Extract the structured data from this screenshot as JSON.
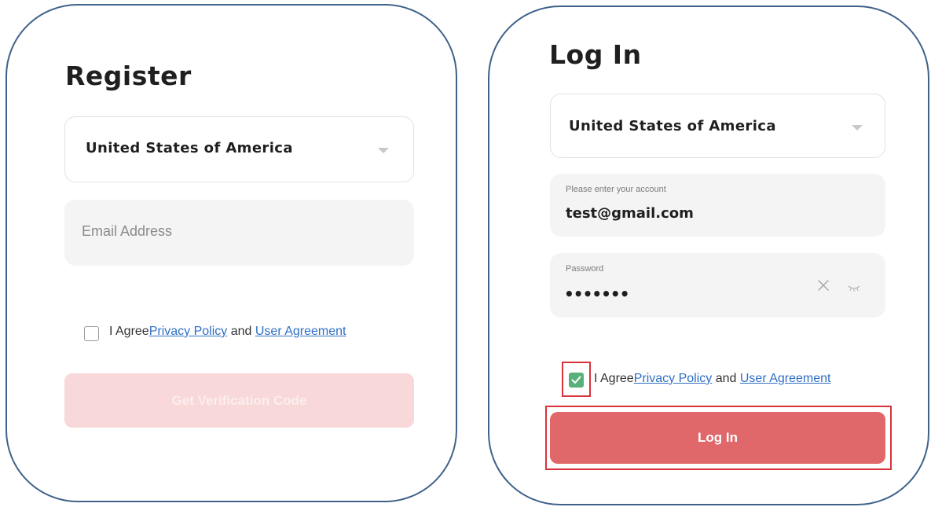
{
  "register": {
    "title": "Register",
    "country": "United States of America",
    "email_placeholder": "Email Address",
    "agree_prefix": "I Agree",
    "privacy_link": "Privacy Policy",
    "and_text": " and ",
    "user_agreement_link": "User Agreement",
    "checkbox_checked": false,
    "submit_label": "Get Verification Code"
  },
  "login": {
    "title": "Log In",
    "country": "United States of America",
    "account_label": "Please enter your account",
    "account_value": "test@gmail.com",
    "password_label": "Password",
    "password_value": "•••••••",
    "agree_prefix": "I Agree",
    "privacy_link": "Privacy Policy",
    "and_text": " and ",
    "user_agreement_link": "User Agreement",
    "checkbox_checked": true,
    "submit_label": "Log In"
  },
  "icons": {
    "caret": "chevron-down-icon",
    "clear": "close-icon",
    "visibility": "eye-closed-icon",
    "check": "checkmark-icon"
  },
  "colors": {
    "panel_border": "#3f6289",
    "link": "#2f6fc4",
    "primary_button": "#e0676a",
    "disabled_button": "#f8d8d9",
    "checkbox_checked": "#58b07a",
    "highlight": "#d9323a",
    "field_bg": "#f4f4f4"
  }
}
